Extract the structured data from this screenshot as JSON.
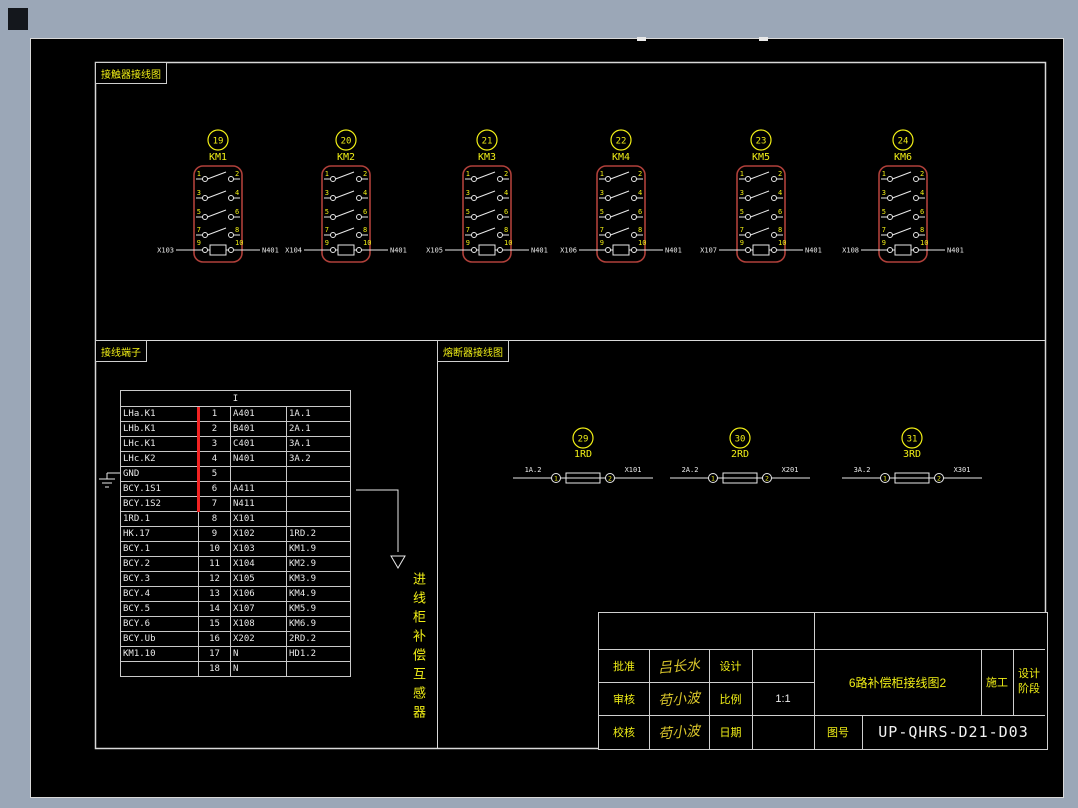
{
  "colors": {
    "background_margin": "#9ba7b7",
    "canvas": "#000000",
    "line_white": "#e9e9e9",
    "annotation_yellow": "#f0ee16",
    "contactor_red": "#b0403a",
    "highlight_red": "#f02222"
  },
  "sections": {
    "contactors_label": "接触器接线图",
    "terminals_label": "接线端子",
    "fuses_label": "熔断器接线图"
  },
  "contactors": {
    "pin_rows": [
      [
        "1",
        "2"
      ],
      [
        "3",
        "4"
      ],
      [
        "5",
        "6"
      ],
      [
        "7",
        "8"
      ]
    ],
    "coil_pins": [
      "9",
      "10"
    ],
    "items": [
      {
        "num": "19",
        "name": "KM1",
        "coil_left": "X103",
        "coil_right": "N401"
      },
      {
        "num": "20",
        "name": "KM2",
        "coil_left": "X104",
        "coil_right": "N401"
      },
      {
        "num": "21",
        "name": "KM3",
        "coil_left": "X105",
        "coil_right": "N401"
      },
      {
        "num": "22",
        "name": "KM4",
        "coil_left": "X106",
        "coil_right": "N401"
      },
      {
        "num": "23",
        "name": "KM5",
        "coil_left": "X107",
        "coil_right": "N401"
      },
      {
        "num": "24",
        "name": "KM6",
        "coil_left": "X108",
        "coil_right": "N401"
      }
    ]
  },
  "fuses": {
    "items": [
      {
        "num": "29",
        "name": "1RD",
        "pin_left": "1",
        "pin_right": "2",
        "wire_left": "1A.2",
        "wire_right": "X101"
      },
      {
        "num": "30",
        "name": "2RD",
        "pin_left": "1",
        "pin_right": "2",
        "wire_left": "2A.2",
        "wire_right": "X201"
      },
      {
        "num": "31",
        "name": "3RD",
        "pin_left": "1",
        "pin_right": "2",
        "wire_left": "3A.2",
        "wire_right": "X301"
      }
    ]
  },
  "terminal_table": {
    "header": "I",
    "rows": [
      [
        "LHa.K1",
        "1",
        "A401",
        "1A.1"
      ],
      [
        "LHb.K1",
        "2",
        "B401",
        "2A.1"
      ],
      [
        "LHc.K1",
        "3",
        "C401",
        "3A.1"
      ],
      [
        "LHc.K2",
        "4",
        "N401",
        "3A.2"
      ],
      [
        "GND",
        "5",
        "",
        ""
      ],
      [
        "BCY.1S1",
        "6",
        "A411",
        ""
      ],
      [
        "BCY.1S2",
        "7",
        "N411",
        ""
      ],
      [
        "1RD.1",
        "8",
        "X101",
        ""
      ],
      [
        "HK.17",
        "9",
        "X102",
        "1RD.2"
      ],
      [
        "BCY.1",
        "10",
        "X103",
        "KM1.9"
      ],
      [
        "BCY.2",
        "11",
        "X104",
        "KM2.9"
      ],
      [
        "BCY.3",
        "12",
        "X105",
        "KM3.9"
      ],
      [
        "BCY.4",
        "13",
        "X106",
        "KM4.9"
      ],
      [
        "BCY.5",
        "14",
        "X107",
        "KM5.9"
      ],
      [
        "BCY.6",
        "15",
        "X108",
        "KM6.9"
      ],
      [
        "BCY.Ub",
        "16",
        "X202",
        "2RD.2"
      ],
      [
        "KM1.10",
        "17",
        "N",
        "HD1.2"
      ],
      [
        "",
        "18",
        "N",
        ""
      ]
    ]
  },
  "side_note": "进线柜补偿互感器",
  "title_block": {
    "approve_label": "批准",
    "approve_sig": "吕长水",
    "review_label": "审核",
    "review_sig": "苟小波",
    "check_label": "校核",
    "check_sig": "苟小波",
    "design_label": "设计",
    "scale_label": "比例",
    "scale_value": "1:1",
    "date_label": "日期",
    "title": "6路补偿柜接线图2",
    "stage_construction": "施工",
    "stage_line1": "设计",
    "stage_line2": "阶段",
    "drawing_no_label": "图号",
    "drawing_no": "UP-QHRS-D21-D03"
  }
}
